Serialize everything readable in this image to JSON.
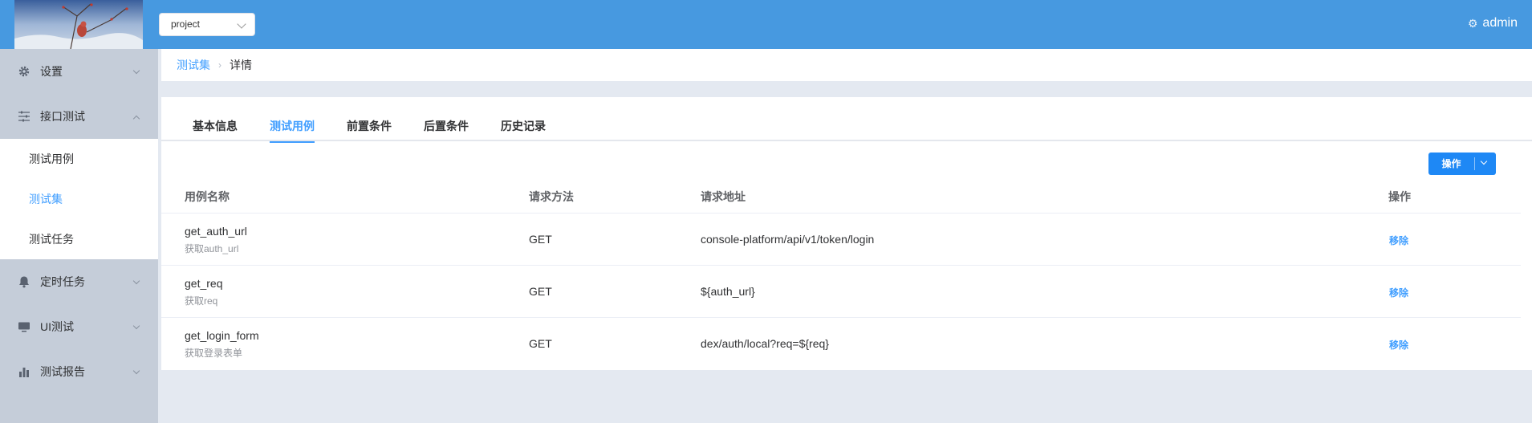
{
  "header": {
    "project_select": "project",
    "user": "admin",
    "user_icon": "gear-icon"
  },
  "sidebar": {
    "items": [
      {
        "label": "设置",
        "icon": "gear-icon"
      },
      {
        "label": "接口测试",
        "icon": "sliders-icon",
        "expanded": true
      },
      {
        "label": "定时任务",
        "icon": "bell-icon"
      },
      {
        "label": "UI测试",
        "icon": "monitor-icon"
      },
      {
        "label": "测试报告",
        "icon": "bar-chart-icon"
      }
    ],
    "submenu": [
      {
        "label": "测试用例"
      },
      {
        "label": "测试集",
        "active": true
      },
      {
        "label": "测试任务"
      }
    ]
  },
  "breadcrumb": {
    "link": "测试集",
    "current": "详情"
  },
  "tabs": [
    {
      "label": "基本信息"
    },
    {
      "label": "测试用例",
      "active": true
    },
    {
      "label": "前置条件"
    },
    {
      "label": "后置条件"
    },
    {
      "label": "历史记录"
    }
  ],
  "toolbar": {
    "operate_label": "操作"
  },
  "table": {
    "columns": [
      "用例名称",
      "请求方法",
      "请求地址",
      "操作"
    ],
    "rows": [
      {
        "name": "get_auth_url",
        "desc": "获取auth_url",
        "method": "GET",
        "url": "console-platform/api/v1/token/login",
        "action": "移除"
      },
      {
        "name": "get_req",
        "desc": "获取req",
        "method": "GET",
        "url": "${auth_url}",
        "action": "移除"
      },
      {
        "name": "get_login_form",
        "desc": "获取登录表单",
        "method": "GET",
        "url": "dex/auth/local?req=${req}",
        "action": "移除"
      }
    ]
  },
  "colors": {
    "header_bg": "#4799e0",
    "accent": "#409eff",
    "sidebar_bg": "#c5cdd9",
    "page_bg": "#e4e9f1"
  }
}
